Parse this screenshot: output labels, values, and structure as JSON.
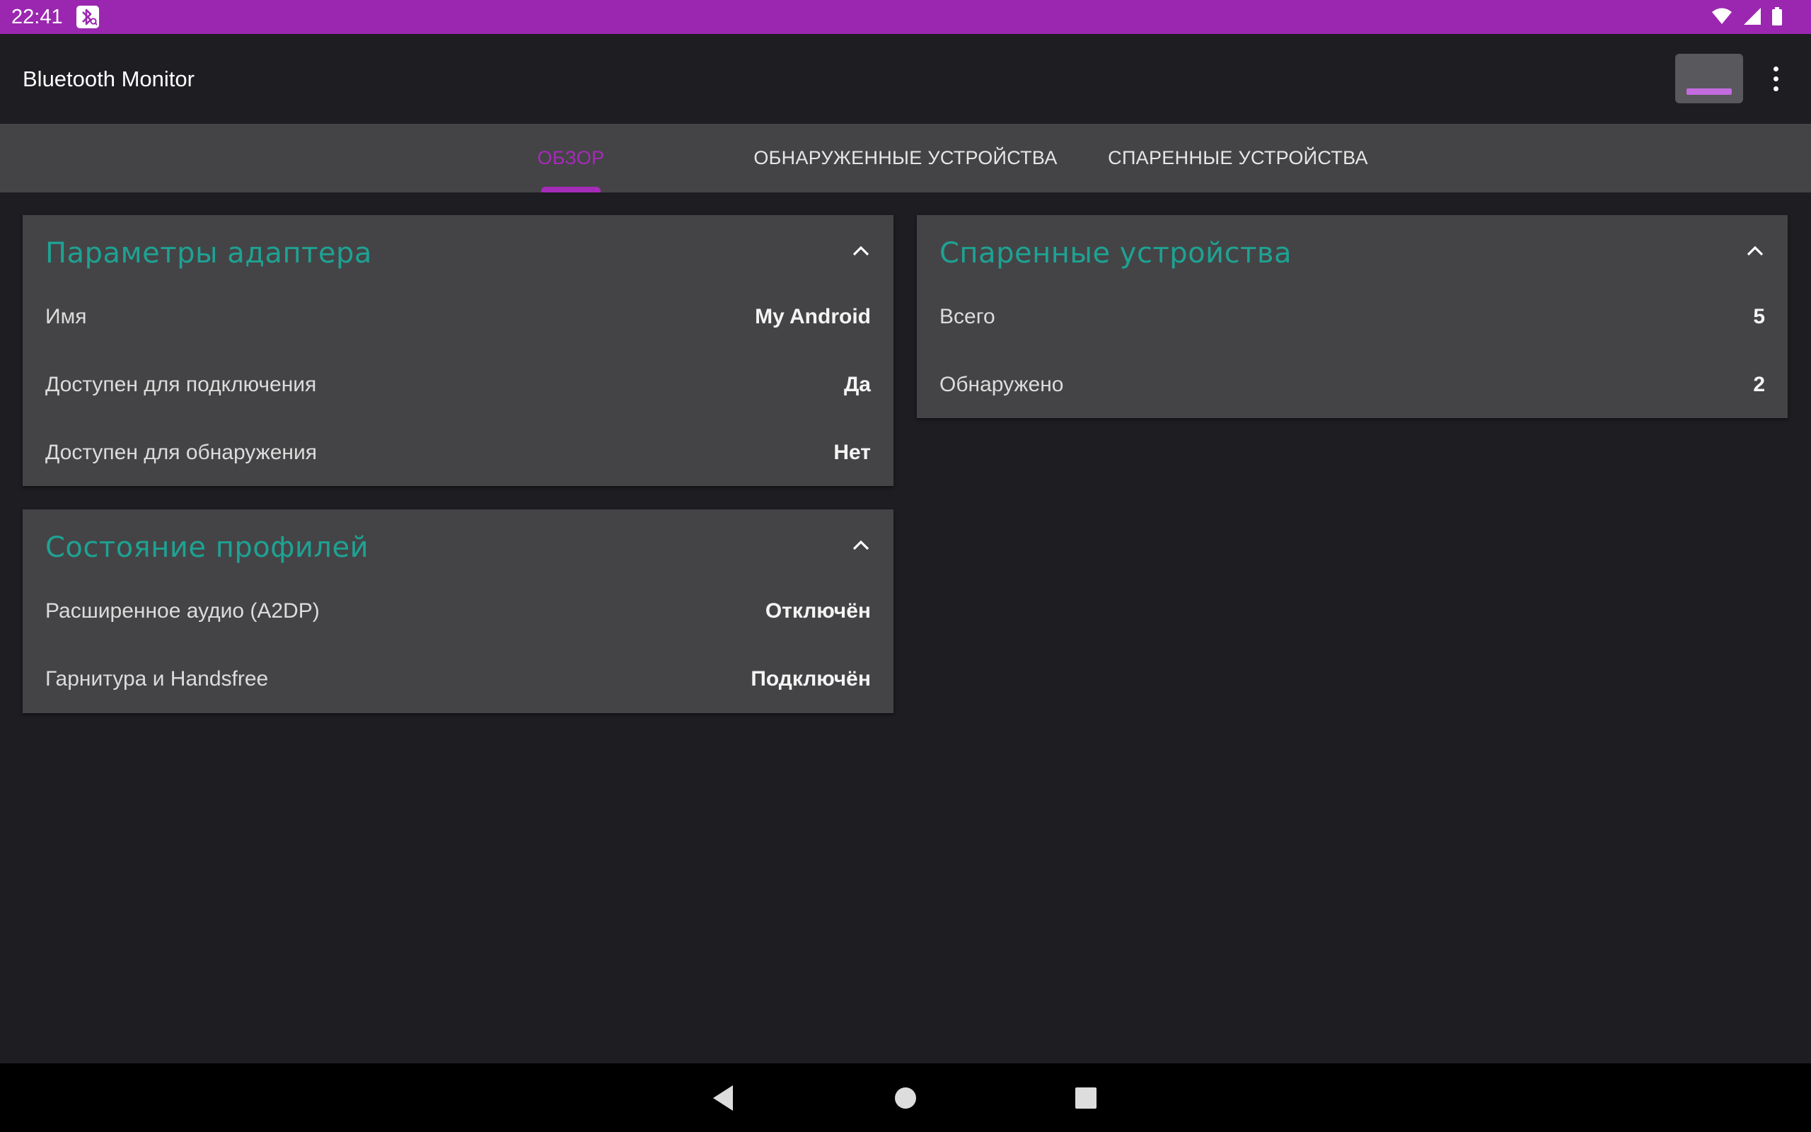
{
  "status_bar": {
    "time": "22:41",
    "icons": [
      "bluetooth-search-icon",
      "wifi-icon",
      "signal-icon",
      "battery-icon"
    ]
  },
  "app_bar": {
    "title": "Bluetooth Monitor",
    "action_icon": "action-window-icon",
    "overflow_icon": "more-vert-icon"
  },
  "tabs": [
    {
      "label": "ОБЗОР",
      "active": true
    },
    {
      "label": "ОБНАРУЖЕННЫЕ УСТРОЙСТВА",
      "active": false
    },
    {
      "label": "СПАРЕННЫЕ УСТРОЙСТВА",
      "active": false
    }
  ],
  "cards": {
    "adapter": {
      "title": "Параметры адаптера",
      "rows": [
        {
          "label": "Имя",
          "value": "My Android"
        },
        {
          "label": "Доступен для подключения",
          "value": "Да"
        },
        {
          "label": "Доступен для обнаружения",
          "value": "Нет"
        }
      ]
    },
    "profiles": {
      "title": "Состояние профилей",
      "rows": [
        {
          "label": "Расширенное аудио (A2DP)",
          "value": "Отключён"
        },
        {
          "label": "Гарнитура и Handsfree",
          "value": "Подключён"
        }
      ]
    },
    "paired": {
      "title": "Спаренные устройства",
      "rows": [
        {
          "label": "Всего",
          "value": "5"
        },
        {
          "label": "Обнаружено",
          "value": "2"
        }
      ]
    }
  },
  "nav_bar": {
    "icons": [
      "back-icon",
      "home-icon",
      "recents-icon"
    ]
  },
  "colors": {
    "status_bar": "#9b27b0",
    "accent": "#a62bb8",
    "card_title": "#1ea293",
    "card_bg": "#444446",
    "background": "#1e1d22"
  }
}
